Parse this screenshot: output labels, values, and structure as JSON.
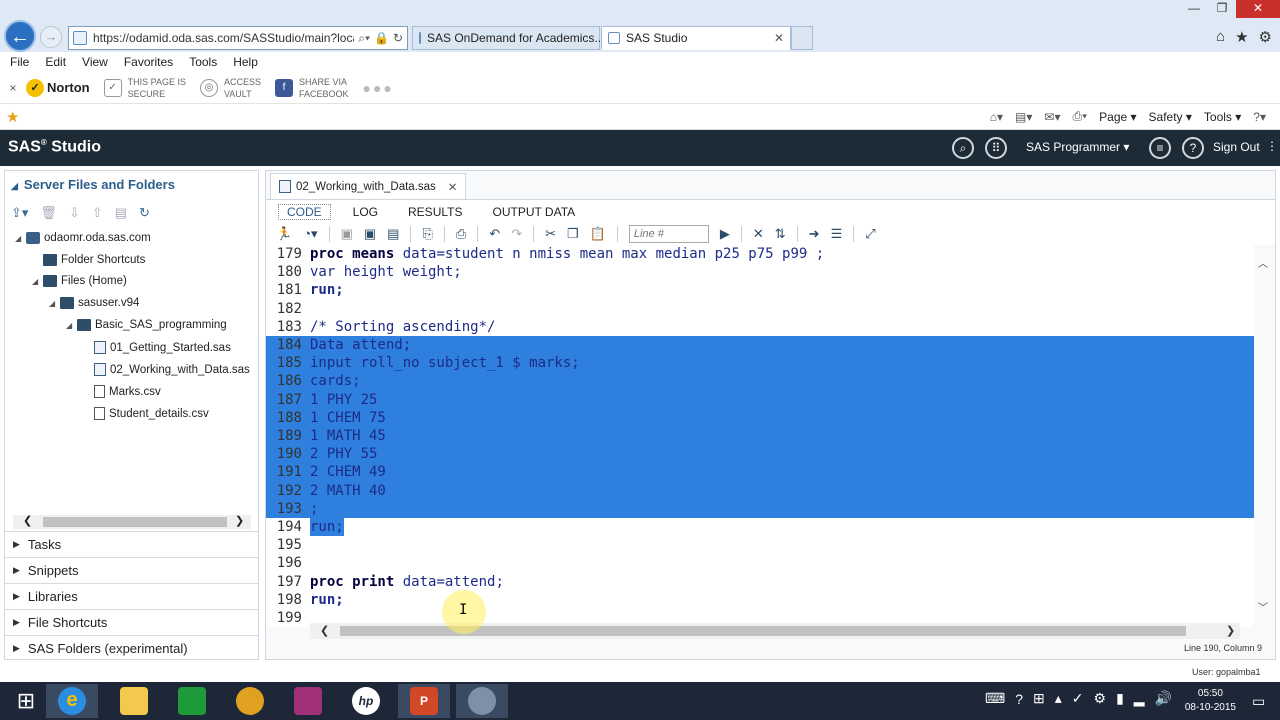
{
  "browser": {
    "url": "https://odamid.oda.sas.com/SASStudio/main?loca",
    "tabs": [
      {
        "label": "SAS OnDemand for Academics..."
      },
      {
        "label": "SAS Studio"
      }
    ],
    "menu": [
      "File",
      "Edit",
      "View",
      "Favorites",
      "Tools",
      "Help"
    ],
    "norton": {
      "close": "×",
      "brand": "Norton",
      "secure_l1": "THIS PAGE IS",
      "secure_l2": "SECURE",
      "vault_l1": "ACCESS",
      "vault_l2": "VAULT",
      "share_l1": "SHARE VIA",
      "share_l2": "FACEBOOK"
    },
    "cmdbar": [
      "Page ▾",
      "Safety ▾",
      "Tools ▾"
    ]
  },
  "sas": {
    "title": "SAS",
    "title_sup": "®",
    "title_rest": " Studio",
    "perspective": "SAS Programmer",
    "signout": "Sign Out"
  },
  "left": {
    "header": "Server Files and Folders",
    "tree": [
      {
        "label": "odaomr.oda.sas.com",
        "type": "server"
      },
      {
        "label": "Folder Shortcuts",
        "type": "folder"
      },
      {
        "label": "Files (Home)",
        "type": "folder"
      },
      {
        "label": "sasuser.v94",
        "type": "folder"
      },
      {
        "label": "Basic_SAS_programming",
        "type": "folder"
      },
      {
        "label": "01_Getting_Started.sas",
        "type": "sas"
      },
      {
        "label": "02_Working_with_Data.sas",
        "type": "sas"
      },
      {
        "label": "Marks.csv",
        "type": "doc"
      },
      {
        "label": "Student_details.csv",
        "type": "doc"
      }
    ],
    "sections": [
      "Tasks",
      "Snippets",
      "Libraries",
      "File Shortcuts",
      "SAS Folders (experimental)"
    ]
  },
  "editor": {
    "file_tab": "02_Working_with_Data.sas",
    "subtabs": [
      "CODE",
      "LOG",
      "RESULTS",
      "OUTPUT DATA"
    ],
    "line_placeholder": "Line #",
    "lines": [
      {
        "n": "179",
        "t": "proc means data=student n nmiss mean max median p25 p75 p99 ;"
      },
      {
        "n": "180",
        "t": "var height weight;"
      },
      {
        "n": "181",
        "t": "run;"
      },
      {
        "n": "182",
        "t": ""
      },
      {
        "n": "183",
        "t": "/* Sorting ascending*/"
      },
      {
        "n": "184",
        "t": "Data attend;"
      },
      {
        "n": "185",
        "t": "input roll_no subject_1 $ marks;"
      },
      {
        "n": "186",
        "t": "cards;"
      },
      {
        "n": "187",
        "t": "1 PHY 25"
      },
      {
        "n": "188",
        "t": "1 CHEM 75"
      },
      {
        "n": "189",
        "t": "1 MATH 45"
      },
      {
        "n": "190",
        "t": "2 PHY 55"
      },
      {
        "n": "191",
        "t": "2 CHEM 49"
      },
      {
        "n": "192",
        "t": "2 MATH 40"
      },
      {
        "n": "193",
        "t": ";"
      },
      {
        "n": "194",
        "t": "run;"
      },
      {
        "n": "195",
        "t": ""
      },
      {
        "n": "196",
        "t": ""
      },
      {
        "n": "197",
        "t": "proc print data=attend;"
      },
      {
        "n": "198",
        "t": "run;"
      },
      {
        "n": "199",
        "t": ""
      }
    ],
    "status": "Line 190, Column 9",
    "user": "User: gopalmba1"
  },
  "taskbar": {
    "time": "05:50",
    "date": "08-10-2015"
  }
}
